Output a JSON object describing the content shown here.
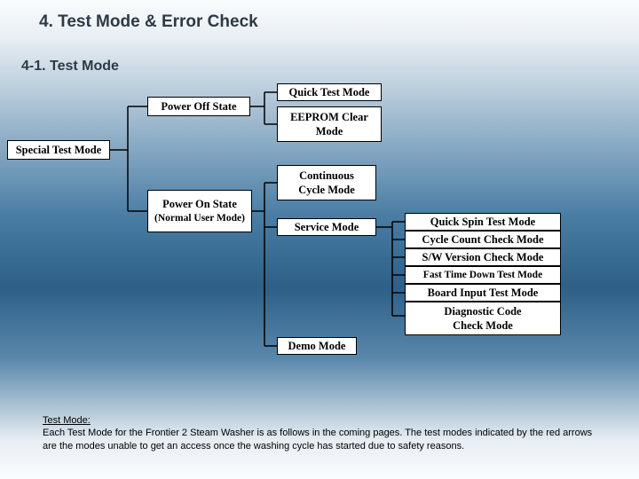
{
  "title": "4. Test Mode & Error Check",
  "subtitle": "4-1. Test Mode",
  "nodes": {
    "special_test_mode": "Special Test Mode",
    "power_off_state": "Power Off State",
    "quick_test_mode": "Quick Test Mode",
    "eeprom_clear_mode_l1": "EEPROM Clear",
    "eeprom_clear_mode_l2": "Mode",
    "power_on_state_l1": "Power On State",
    "power_on_state_l2": "(Normal User Mode)",
    "continuous_cycle_l1": "Continuous",
    "continuous_cycle_l2": "Cycle Mode",
    "service_mode": "Service Mode",
    "demo_mode": "Demo Mode",
    "quick_spin_test_mode": "Quick Spin Test Mode",
    "cycle_count_check_mode": "Cycle Count Check Mode",
    "sw_version_check_mode": "S/W Version Check Mode",
    "fast_time_down_test_mode": "Fast Time Down Test Mode",
    "board_input_test_mode": "Board Input Test Mode",
    "diagnostic_code_check_l1": "Diagnostic Code",
    "diagnostic_code_check_l2": "Check Mode"
  },
  "footer": {
    "heading": "Test Mode:",
    "body": "Each Test Mode for the Frontier 2 Steam Washer is as follows in the coming pages.  The test modes indicated by the red arrows are the modes unable to get an access once the washing cycle has started due to safety reasons."
  },
  "chart_data": {
    "type": "tree",
    "root": "Special Test Mode",
    "children": [
      {
        "name": "Power Off State",
        "children": [
          {
            "name": "Quick Test Mode"
          },
          {
            "name": "EEPROM Clear Mode"
          }
        ]
      },
      {
        "name": "Power On State (Normal User Mode)",
        "children": [
          {
            "name": "Continuous Cycle Mode"
          },
          {
            "name": "Service Mode",
            "children": [
              {
                "name": "Quick Spin Test Mode"
              },
              {
                "name": "Cycle Count Check Mode"
              },
              {
                "name": "S/W Version Check Mode"
              },
              {
                "name": "Fast Time Down Test Mode"
              },
              {
                "name": "Board Input Test Mode"
              },
              {
                "name": "Diagnostic Code Check Mode"
              }
            ]
          },
          {
            "name": "Demo Mode"
          }
        ]
      }
    ]
  }
}
